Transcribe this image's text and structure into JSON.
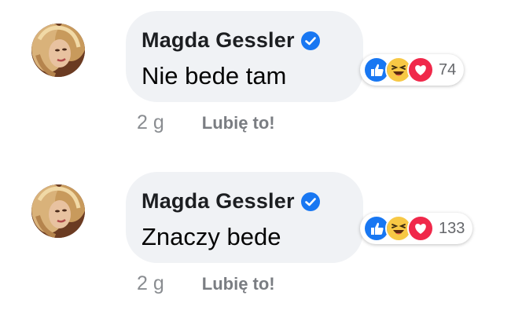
{
  "comments": [
    {
      "author": "Magda Gessler",
      "text": "Nie bede tam",
      "reaction_count": "74",
      "reactions": [
        "like-icon",
        "haha-icon",
        "love-icon"
      ],
      "time": "2 g",
      "like_label": "Lubię to!"
    },
    {
      "author": "Magda Gessler",
      "text": "Znaczy bede",
      "reaction_count": "133",
      "reactions": [
        "like-icon",
        "haha-icon",
        "love-icon"
      ],
      "time": "2 g",
      "like_label": "Lubię to!"
    }
  ],
  "colors": {
    "bubble": "#f0f2f5",
    "verified": "#1877f2",
    "like": "#1877f2",
    "haha": "#f7c845",
    "love": "#f0284a",
    "meta": "#8a8d91"
  }
}
